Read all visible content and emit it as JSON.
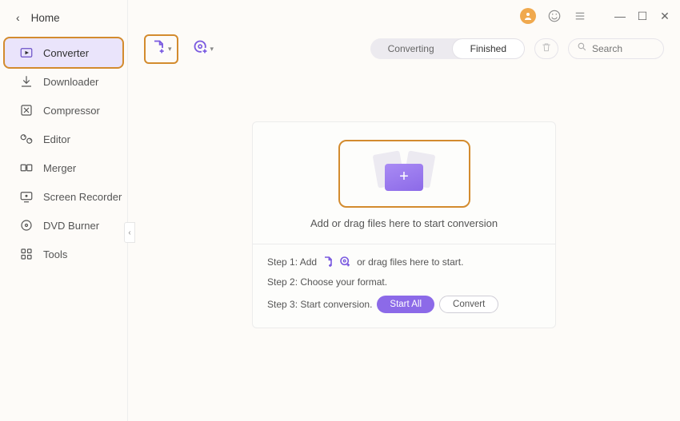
{
  "home_label": "Home",
  "sidebar": {
    "items": [
      {
        "label": "Converter"
      },
      {
        "label": "Downloader"
      },
      {
        "label": "Compressor"
      },
      {
        "label": "Editor"
      },
      {
        "label": "Merger"
      },
      {
        "label": "Screen Recorder"
      },
      {
        "label": "DVD Burner"
      },
      {
        "label": "Tools"
      }
    ]
  },
  "toolbar": {
    "tabs": {
      "converting": "Converting",
      "finished": "Finished"
    },
    "search_placeholder": "Search"
  },
  "drop": {
    "headline": "Add or drag files here to start conversion",
    "step1_pre": "Step 1: Add",
    "step1_post": "or drag files here to start.",
    "step2": "Step 2: Choose your format.",
    "step3": "Step 3: Start conversion.",
    "start_all": "Start All",
    "convert": "Convert"
  },
  "colors": {
    "accent": "#8c6ae8",
    "highlight": "#d38b2e"
  }
}
